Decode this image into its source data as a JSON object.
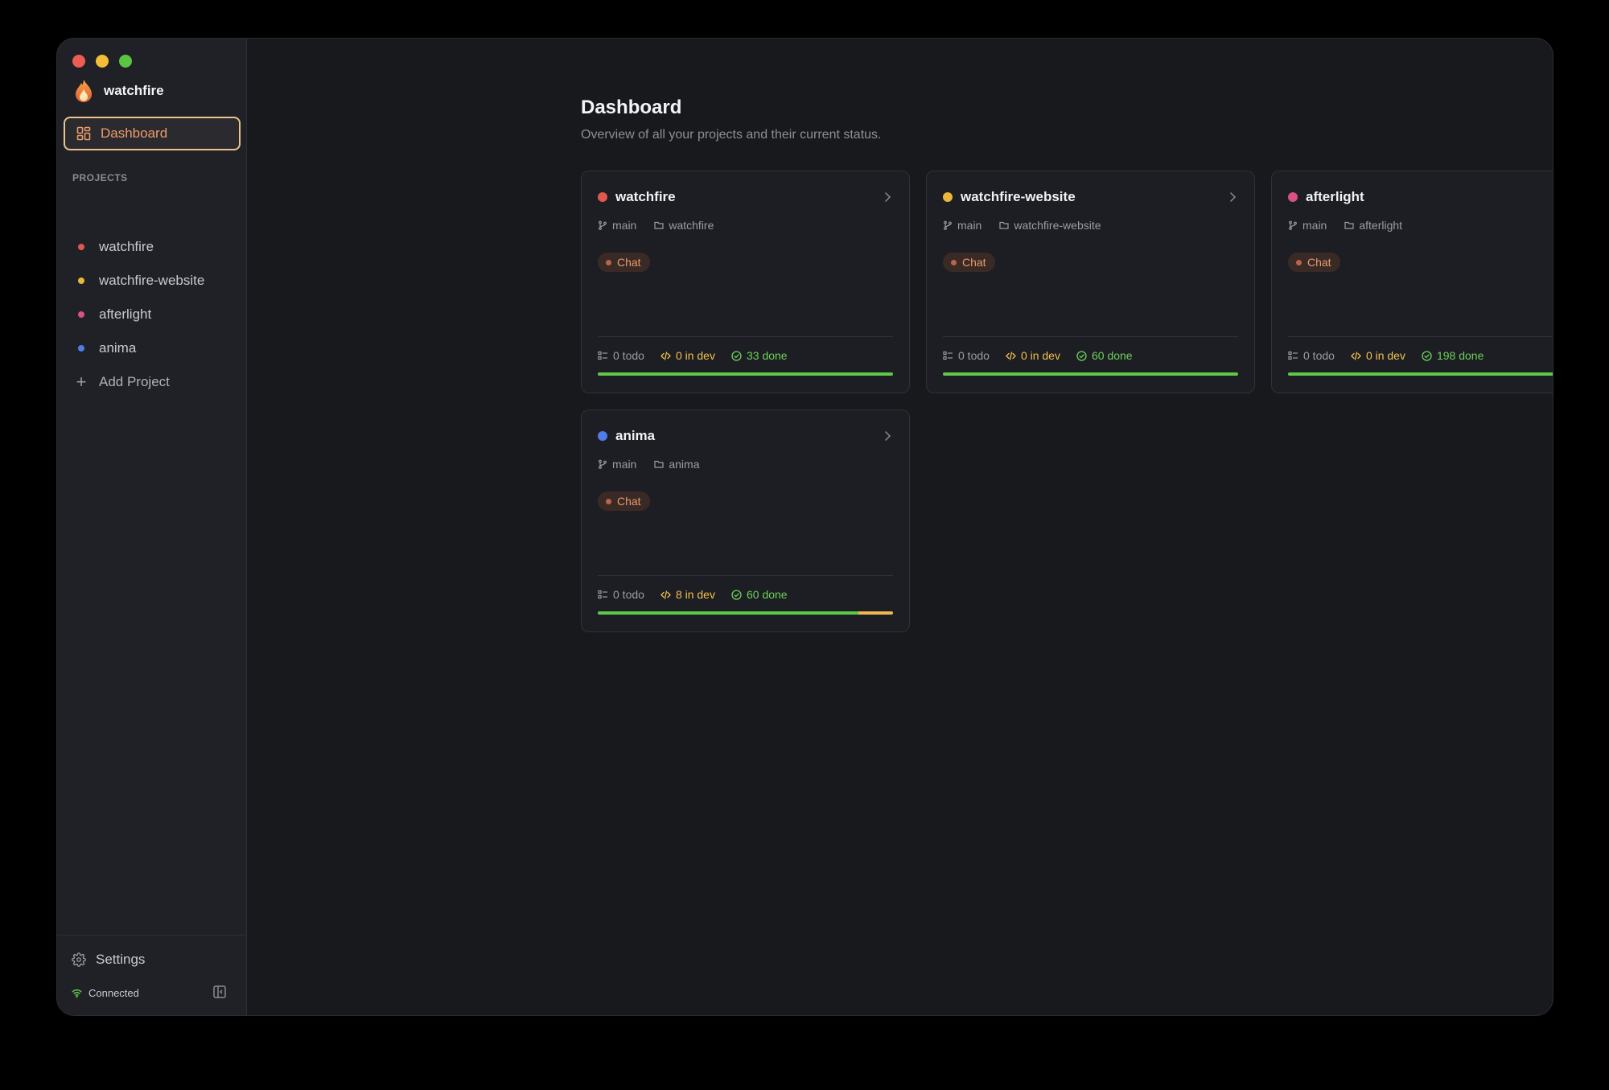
{
  "app": {
    "name": "watchfire"
  },
  "sidebar": {
    "dashboard_label": "Dashboard",
    "projects_section": "PROJECTS",
    "projects": [
      {
        "label": "watchfire",
        "color": "#e0574f"
      },
      {
        "label": "watchfire-website",
        "color": "#e9b73a"
      },
      {
        "label": "afterlight",
        "color": "#d94f88"
      },
      {
        "label": "anima",
        "color": "#4f7ee8"
      }
    ],
    "add_project_label": "Add Project",
    "settings_label": "Settings",
    "connection_status": "Connected"
  },
  "main": {
    "title": "Dashboard",
    "subtitle": "Overview of all your projects and their current status.",
    "cards": [
      {
        "name": "watchfire",
        "color": "#e0574f",
        "branch": "main",
        "folder": "watchfire",
        "badge": "Chat",
        "todo": "0 todo",
        "dev": "0 in dev",
        "done": "33 done",
        "progress_done": 1.0,
        "progress_dev": 0.0
      },
      {
        "name": "watchfire-website",
        "color": "#e9b73a",
        "branch": "main",
        "folder": "watchfire-website",
        "badge": "Chat",
        "todo": "0 todo",
        "dev": "0 in dev",
        "done": "60 done",
        "progress_done": 1.0,
        "progress_dev": 0.0
      },
      {
        "name": "afterlight",
        "color": "#d94f88",
        "branch": "main",
        "folder": "afterlight",
        "badge": "Chat",
        "todo": "0 todo",
        "dev": "0 in dev",
        "done": "198 done",
        "progress_done": 1.0,
        "progress_dev": 0.0
      },
      {
        "name": "anima",
        "color": "#4f7ee8",
        "branch": "main",
        "folder": "anima",
        "badge": "Chat",
        "todo": "0 todo",
        "dev": "8 in dev",
        "done": "60 done",
        "progress_done": 0.882,
        "progress_dev": 0.118
      }
    ]
  }
}
